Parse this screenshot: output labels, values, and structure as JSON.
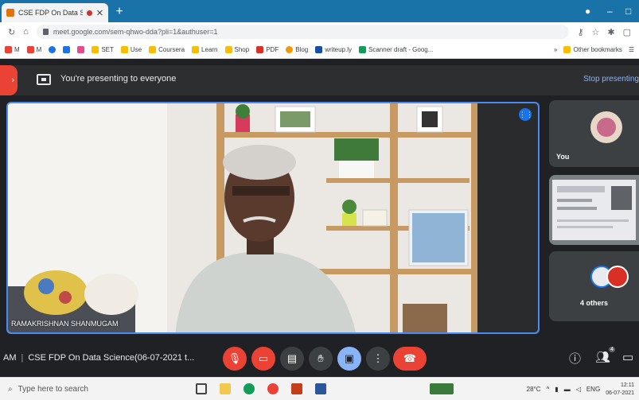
{
  "browser": {
    "tab_title": "CSE FDP On Data Sc",
    "url": "meet.google.com/sem-qhwo-dda?pli=1&authuser=1",
    "bookmarks": [
      "M",
      "M",
      "",
      "",
      "",
      "SET",
      "Use",
      "Coursera",
      "Learn",
      "Shop",
      "PDF",
      "Blog",
      "writeup.ly",
      "Scanner draft - Goog..."
    ],
    "other_bookmarks": "Other bookmarks"
  },
  "meet": {
    "presenting_text": "You're presenting to everyone",
    "stop_presenting": "Stop presenting",
    "speaker_name": "RAMAKRISHNAN SHANMUGAM",
    "you_label": "You",
    "others_label": "4 others",
    "participant_count": "4",
    "meeting_time": "AM",
    "meeting_title": "CSE FDP On Data Science(06-07-2021 t..."
  },
  "taskbar": {
    "search_placeholder": "Type here to search",
    "weather": "28°C",
    "lang": "ENG",
    "time": "12:11",
    "date": "06-07-2021"
  },
  "colors": {
    "accent": "#1a73e8",
    "danger": "#ea4335",
    "meet_bg": "#202124"
  }
}
